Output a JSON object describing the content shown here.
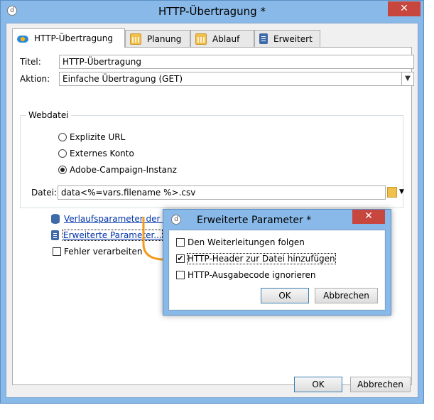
{
  "window": {
    "title": "HTTP-Übertragung *",
    "close_glyph": "✕"
  },
  "tabs": [
    {
      "label": "HTTP-Übertragung",
      "icon": "cloud-icon"
    },
    {
      "label": "Planung",
      "icon": "calendar-icon"
    },
    {
      "label": "Ablauf",
      "icon": "calendar-icon"
    },
    {
      "label": "Erweitert",
      "icon": "clipboard-icon"
    }
  ],
  "form": {
    "titel_label": "Titel:",
    "titel_value": "HTTP-Übertragung",
    "aktion_label": "Aktion:",
    "aktion_value": "Einfache Übertragung (GET)",
    "webdatei_title": "Webdatei",
    "radios": [
      {
        "label": "Explizite URL",
        "selected": false
      },
      {
        "label": "Externes Konto",
        "selected": false
      },
      {
        "label": "Adobe-Campaign-Instanz",
        "selected": true
      }
    ],
    "datei_label": "Datei:",
    "datei_value": "data<%=vars.filename %>.csv",
    "link_history": "Verlaufsparameter der Dateien...",
    "link_advanced": "Erweiterte Parameter...",
    "fehler_label": "Fehler verarbeiten"
  },
  "buttons": {
    "ok": "OK",
    "cancel": "Abbrechen"
  },
  "subdialog": {
    "title": "Erweiterte Parameter *",
    "close_glyph": "✕",
    "options": [
      {
        "label": "Den Weiterleitungen folgen",
        "checked": false
      },
      {
        "label": "HTTP-Header zur Datei hinzufügen",
        "checked": true
      },
      {
        "label": "HTTP-Ausgabecode ignorieren",
        "checked": false
      }
    ],
    "ok": "OK",
    "cancel": "Abbrechen"
  },
  "colors": {
    "accent_arrow": "#f39a1c",
    "close_red": "#c7463e",
    "frame_blue": "#89b9e8",
    "link": "#0033aa"
  }
}
